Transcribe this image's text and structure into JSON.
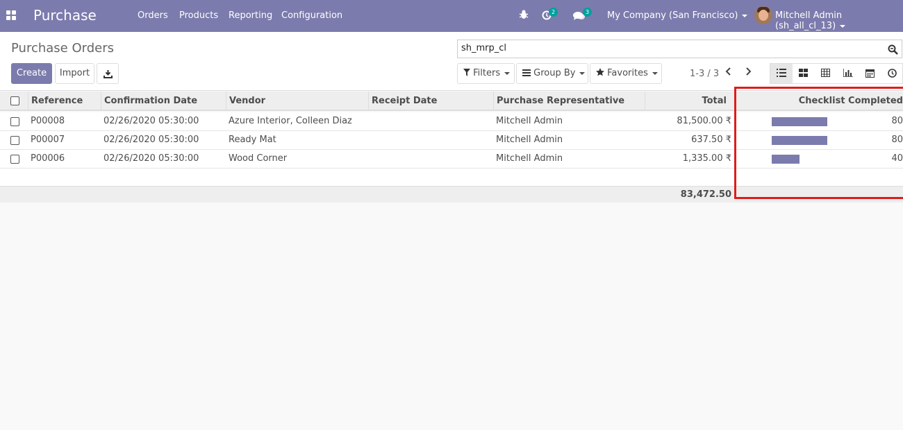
{
  "navbar": {
    "app_title": "Purchase",
    "menu": [
      "Orders",
      "Products",
      "Reporting",
      "Configuration"
    ],
    "activity_count": "2",
    "message_count": "3",
    "company": "My Company (San Francisco)",
    "user": "Mitchell Admin (sh_all_cl_13)",
    "color": "#7c7bad"
  },
  "control_panel": {
    "title": "Purchase Orders",
    "create_label": "Create",
    "import_label": "Import",
    "search_value": "sh_mrp_cl",
    "filters_label": "Filters",
    "groupby_label": "Group By",
    "favorites_label": "Favorites",
    "pager": "1-3 / 3",
    "views": [
      "list-view-icon",
      "kanban-view-icon",
      "pivot-view-icon",
      "graph-view-icon",
      "calendar-view-icon",
      "activity-view-icon"
    ],
    "active_view": "list-view-icon"
  },
  "table": {
    "columns": [
      "Reference",
      "Confirmation Date",
      "Vendor",
      "Receipt Date",
      "Purchase Representative",
      "Total",
      "Checklist Completed"
    ],
    "rows": [
      {
        "reference": "P00008",
        "confirmation_date": "02/26/2020 05:30:00",
        "vendor": "Azure Interior, Colleen Diaz",
        "receipt_date": "",
        "representative": "Mitchell Admin",
        "total": "81,500.00 ₹",
        "checklist": "80",
        "checklist_pct": 80
      },
      {
        "reference": "P00007",
        "confirmation_date": "02/26/2020 05:30:00",
        "vendor": "Ready Mat",
        "receipt_date": "",
        "representative": "Mitchell Admin",
        "total": "637.50 ₹",
        "checklist": "80",
        "checklist_pct": 80
      },
      {
        "reference": "P00006",
        "confirmation_date": "02/26/2020 05:30:00",
        "vendor": "Wood Corner",
        "receipt_date": "",
        "representative": "Mitchell Admin",
        "total": "1,335.00 ₹",
        "checklist": "40",
        "checklist_pct": 40
      }
    ],
    "footer_total": "83,472.50"
  },
  "highlight_color": "#e01b1b"
}
